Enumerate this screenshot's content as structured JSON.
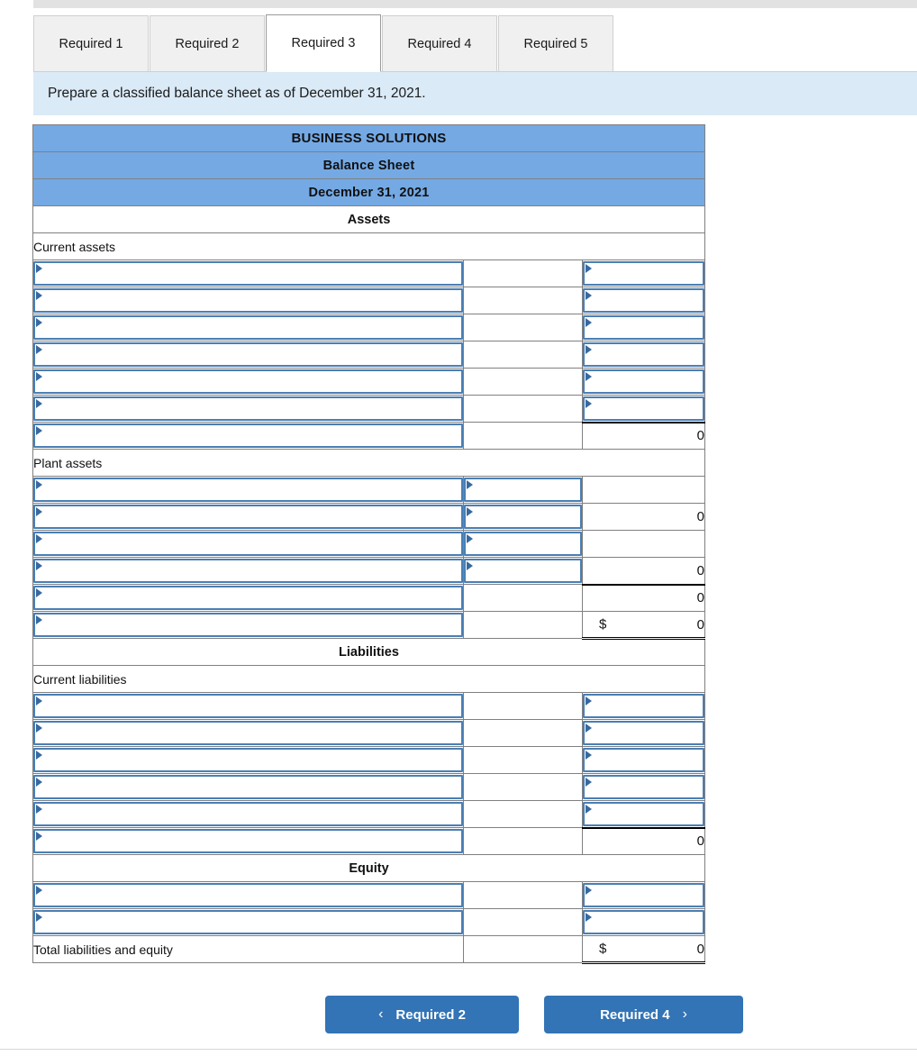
{
  "tabs": [
    {
      "label": "Required 1",
      "active": false
    },
    {
      "label": "Required 2",
      "active": false
    },
    {
      "label": "Required 3",
      "active": true
    },
    {
      "label": "Required 4",
      "active": false
    },
    {
      "label": "Required 5",
      "active": false
    }
  ],
  "instruction": "Prepare a classified balance sheet as of December 31, 2021.",
  "sheet": {
    "company": "BUSINESS SOLUTIONS",
    "statement": "Balance Sheet",
    "date": "December 31, 2021",
    "section_assets": "Assets",
    "label_current_assets": "Current assets",
    "label_plant_assets": "Plant assets",
    "section_liabilities": "Liabilities",
    "label_current_liabilities": "Current liabilities",
    "section_equity": "Equity",
    "label_total_liab_equity": "Total liabilities and equity",
    "zero": "0",
    "dollar": "$",
    "empty": "",
    "accent_header_blue": "#74a9e4",
    "accent_banner_blue": "#daeaf7",
    "accent_button_blue": "#3274b5",
    "select_border_blue": "#4a7fb5"
  },
  "nav": {
    "prev_label": "Required 2",
    "next_label": "Required 4",
    "prev_chevron": "‹",
    "next_chevron": "›"
  }
}
